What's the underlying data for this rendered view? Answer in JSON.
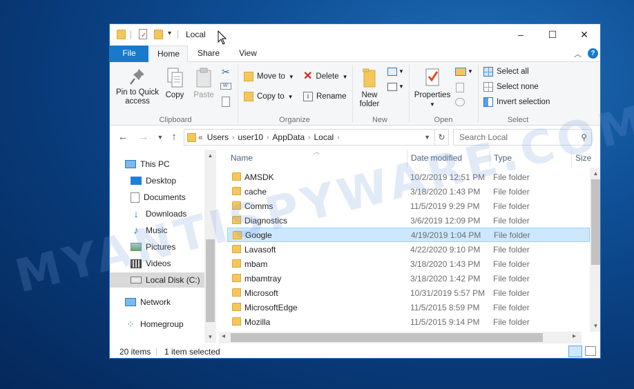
{
  "window": {
    "title": "Local",
    "controls": {
      "minimize": "–",
      "maximize": "☐",
      "close": "✕"
    }
  },
  "ribbon_tabs": [
    {
      "label": "File"
    },
    {
      "label": "Home"
    },
    {
      "label": "Share"
    },
    {
      "label": "View"
    }
  ],
  "ribbon": {
    "clipboard": {
      "pin_label_line1": "Pin to Quick",
      "pin_label_line2": "access",
      "copy_label": "Copy",
      "paste_label": "Paste",
      "group_label": "Clipboard"
    },
    "organize": {
      "move_to": "Move to",
      "copy_to": "Copy to",
      "delete": "Delete",
      "rename": "Rename",
      "group_label": "Organize"
    },
    "new": {
      "new_folder_line1": "New",
      "new_folder_line2": "folder",
      "group_label": "New"
    },
    "open": {
      "properties": "Properties",
      "group_label": "Open"
    },
    "select": {
      "select_all": "Select all",
      "select_none": "Select none",
      "invert": "Invert selection",
      "group_label": "Select"
    }
  },
  "address": {
    "overflow": "«",
    "crumbs": [
      "Users",
      "user10",
      "AppData",
      "Local"
    ],
    "search_placeholder": "Search Local"
  },
  "nav_pane": [
    {
      "label": "This PC",
      "icon": "pc-icon"
    },
    {
      "label": "Desktop",
      "icon": "desktop-icon"
    },
    {
      "label": "Documents",
      "icon": "documents-icon"
    },
    {
      "label": "Downloads",
      "icon": "downloads-icon"
    },
    {
      "label": "Music",
      "icon": "music-icon"
    },
    {
      "label": "Pictures",
      "icon": "pictures-icon"
    },
    {
      "label": "Videos",
      "icon": "videos-icon"
    },
    {
      "label": "Local Disk (C:)",
      "icon": "drive-icon",
      "selected": true
    },
    {
      "label": "Network",
      "icon": "network-icon"
    },
    {
      "label": "Homegroup",
      "icon": "homegroup-icon"
    }
  ],
  "columns": [
    "Name",
    "Date modified",
    "Type",
    "Size"
  ],
  "files": [
    {
      "name": "AMSDK",
      "date": "10/2/2019 12:51 PM",
      "type": "File folder"
    },
    {
      "name": "cache",
      "date": "3/18/2020 1:43 PM",
      "type": "File folder"
    },
    {
      "name": "Comms",
      "date": "11/5/2019 9:29 PM",
      "type": "File folder"
    },
    {
      "name": "Diagnostics",
      "date": "3/6/2019 12:09 PM",
      "type": "File folder"
    },
    {
      "name": "Google",
      "date": "4/19/2019 1:04 PM",
      "type": "File folder",
      "selected": true
    },
    {
      "name": "Lavasoft",
      "date": "4/22/2020 9:10 PM",
      "type": "File folder"
    },
    {
      "name": "mbam",
      "date": "3/18/2020 1:43 PM",
      "type": "File folder"
    },
    {
      "name": "mbamtray",
      "date": "3/18/2020 1:42 PM",
      "type": "File folder"
    },
    {
      "name": "Microsoft",
      "date": "10/31/2019 5:57 PM",
      "type": "File folder"
    },
    {
      "name": "MicrosoftEdge",
      "date": "11/5/2015 8:59 PM",
      "type": "File folder"
    },
    {
      "name": "Mozilla",
      "date": "11/5/2015 9:14 PM",
      "type": "File folder"
    }
  ],
  "status": {
    "items": "20 items",
    "selected": "1 item selected"
  },
  "watermark": "MYANTISPYWARE.COM",
  "colors": {
    "accent": "#1979ca",
    "selection": "#cce8ff",
    "folder": "#f5c75b"
  }
}
